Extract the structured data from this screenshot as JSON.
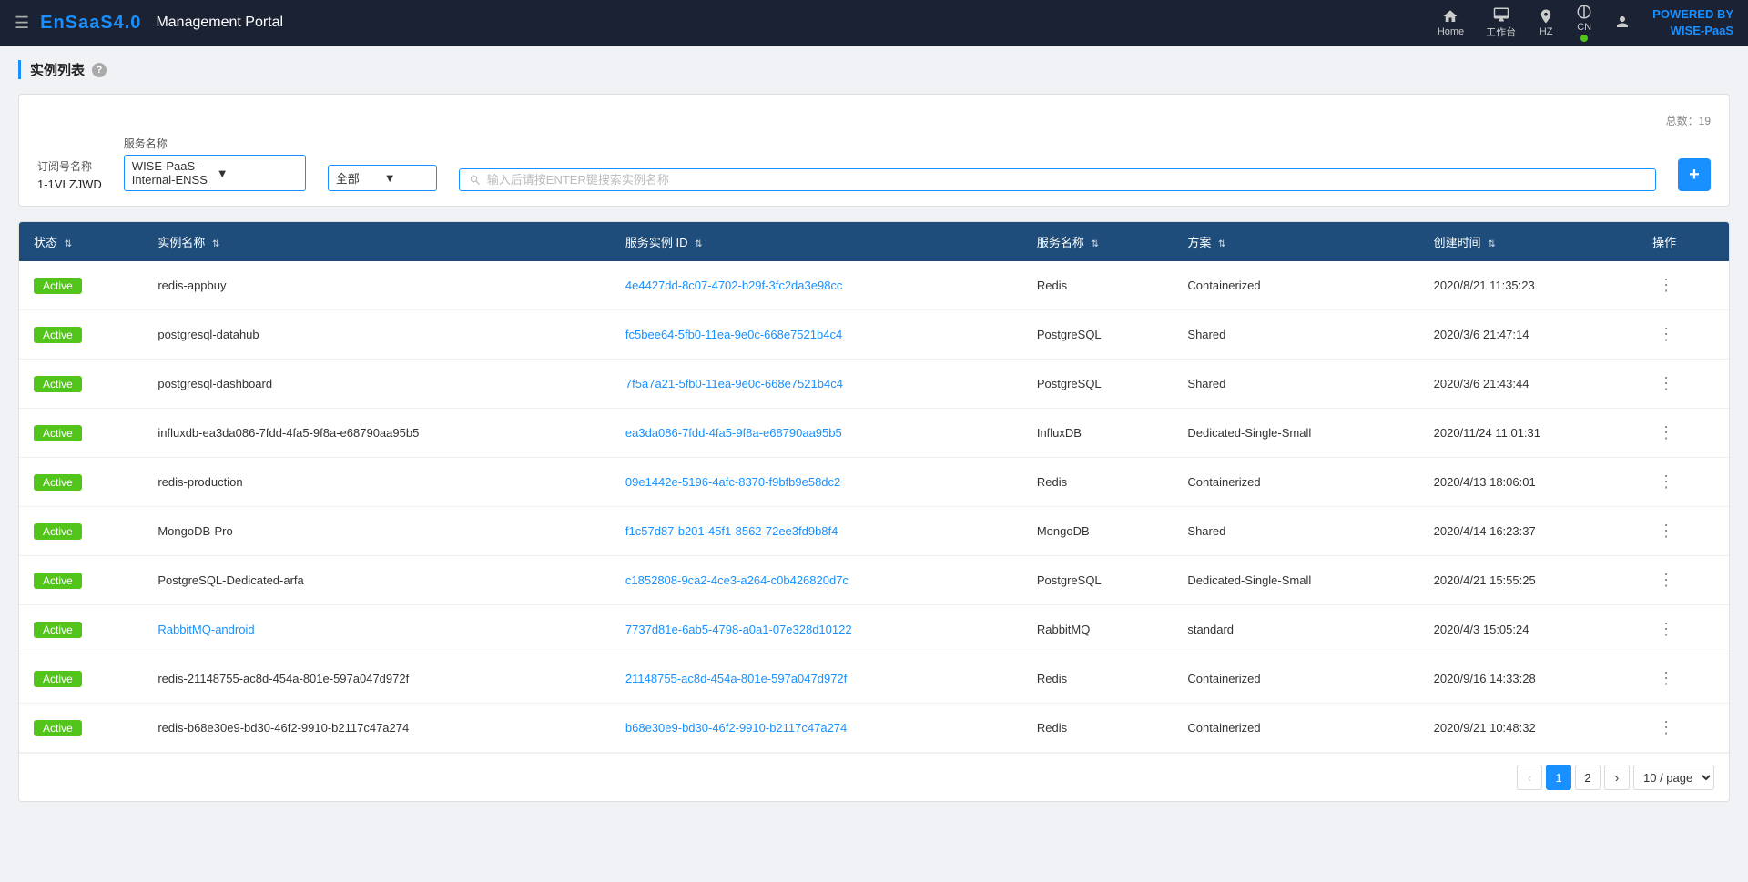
{
  "topnav": {
    "menu_icon": "☰",
    "logo": "EnSaaS4.0",
    "title": "Management Portal",
    "nav_items": [
      {
        "icon": "home",
        "label": "Home"
      },
      {
        "icon": "monitor",
        "label": "工作台"
      },
      {
        "icon": "location",
        "label": "HZ"
      },
      {
        "icon": "globe",
        "label": "CN"
      },
      {
        "icon": "user",
        "label": ""
      }
    ],
    "powered_by": "POWERED BY",
    "powered_name": "WISE-PaaS"
  },
  "page": {
    "title": "实例列表",
    "help_icon": "?"
  },
  "filter": {
    "subscription_label": "订阅号名称",
    "subscription_value": "1-1VLZJWD",
    "service_label": "服务名称",
    "service_value": "WISE-PaaS-Internal-ENSS",
    "service_option": "全部",
    "search_placeholder": "输入后请按ENTER键搜索实例名称",
    "total_label": "总数：",
    "total_count": "19",
    "add_button": "+"
  },
  "table": {
    "columns": [
      {
        "key": "status",
        "label": "状态",
        "sortable": true
      },
      {
        "key": "name",
        "label": "实例名称",
        "sortable": true
      },
      {
        "key": "service_id",
        "label": "服务实例 ID",
        "sortable": true
      },
      {
        "key": "service_name",
        "label": "服务名称",
        "sortable": true
      },
      {
        "key": "plan",
        "label": "方案",
        "sortable": true
      },
      {
        "key": "created",
        "label": "创建时间",
        "sortable": true
      },
      {
        "key": "action",
        "label": "操作",
        "sortable": false
      }
    ],
    "rows": [
      {
        "status": "Active",
        "name": "redis-appbuy",
        "name_link": false,
        "service_id": "4e4427dd-8c07-4702-b29f-3fc2da3e98cc",
        "service_name": "Redis",
        "plan": "Containerized",
        "created": "2020/8/21 11:35:23"
      },
      {
        "status": "Active",
        "name": "postgresql-datahub",
        "name_link": false,
        "service_id": "fc5bee64-5fb0-11ea-9e0c-668e7521b4c4",
        "service_name": "PostgreSQL",
        "plan": "Shared",
        "created": "2020/3/6 21:47:14"
      },
      {
        "status": "Active",
        "name": "postgresql-dashboard",
        "name_link": false,
        "service_id": "7f5a7a21-5fb0-11ea-9e0c-668e7521b4c4",
        "service_name": "PostgreSQL",
        "plan": "Shared",
        "created": "2020/3/6 21:43:44"
      },
      {
        "status": "Active",
        "name": "influxdb-ea3da086-7fdd-4fa5-9f8a-e68790aa95b5",
        "name_link": false,
        "service_id": "ea3da086-7fdd-4fa5-9f8a-e68790aa95b5",
        "service_name": "InfluxDB",
        "plan": "Dedicated-Single-Small",
        "created": "2020/11/24 11:01:31"
      },
      {
        "status": "Active",
        "name": "redis-production",
        "name_link": false,
        "service_id": "09e1442e-5196-4afc-8370-f9bfb9e58dc2",
        "service_name": "Redis",
        "plan": "Containerized",
        "created": "2020/4/13 18:06:01"
      },
      {
        "status": "Active",
        "name": "MongoDB-Pro",
        "name_link": false,
        "service_id": "f1c57d87-b201-45f1-8562-72ee3fd9b8f4",
        "service_name": "MongoDB",
        "plan": "Shared",
        "created": "2020/4/14 16:23:37"
      },
      {
        "status": "Active",
        "name": "PostgreSQL-Dedicated-arfa",
        "name_link": false,
        "service_id": "c1852808-9ca2-4ce3-a264-c0b426820d7c",
        "service_name": "PostgreSQL",
        "plan": "Dedicated-Single-Small",
        "created": "2020/4/21 15:55:25"
      },
      {
        "status": "Active",
        "name": "RabbitMQ-android",
        "name_link": true,
        "service_id": "7737d81e-6ab5-4798-a0a1-07e328d10122",
        "service_name": "RabbitMQ",
        "plan": "standard",
        "created": "2020/4/3 15:05:24"
      },
      {
        "status": "Active",
        "name": "redis-21148755-ac8d-454a-801e-597a047d972f",
        "name_link": false,
        "service_id": "21148755-ac8d-454a-801e-597a047d972f",
        "service_name": "Redis",
        "plan": "Containerized",
        "created": "2020/9/16 14:33:28"
      },
      {
        "status": "Active",
        "name": "redis-b68e30e9-bd30-46f2-9910-b2117c47a274",
        "name_link": false,
        "service_id": "b68e30e9-bd30-46f2-9910-b2117c47a274",
        "service_name": "Redis",
        "plan": "Containerized",
        "created": "2020/9/21 10:48:32"
      }
    ]
  },
  "pagination": {
    "prev_label": "‹",
    "next_label": "›",
    "current_page": 1,
    "total_pages": 2,
    "page_size_label": "10 / page",
    "pages": [
      1,
      2
    ]
  }
}
